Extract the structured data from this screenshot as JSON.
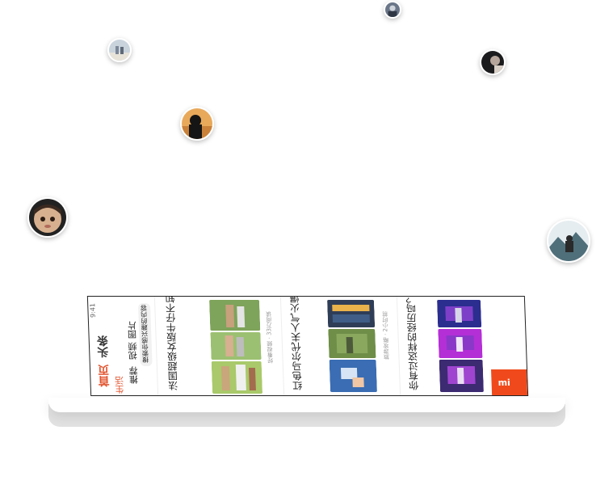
{
  "app": {
    "tabs": [
      "首页",
      "头条",
      "生活"
    ],
    "subtabs": [
      "推荐",
      "视频",
      "图片",
      "新闻"
    ],
    "search_placeholder": "搜索你感兴趣的内容"
  },
  "feed": [
    {
      "title": "法国超级女版牛仔不知名的小姐姐们的日常生活太有意思了",
      "meta": "好看视频 · 33万阅读"
    },
    {
      "title": "红色马尔代夫人气火爆 游客也越来越多 这里适合度假",
      "meta": "旅游攻略 · 2小时前"
    },
    {
      "title": "你有过这样的经历吗？ 真的太真实了",
      "meta": "热门视频"
    }
  ],
  "status": {
    "time": "9:41"
  },
  "bottom_button": {
    "label": "mi"
  },
  "colors": {
    "accent": "#e2532d",
    "bottom": "#f04a1c"
  }
}
